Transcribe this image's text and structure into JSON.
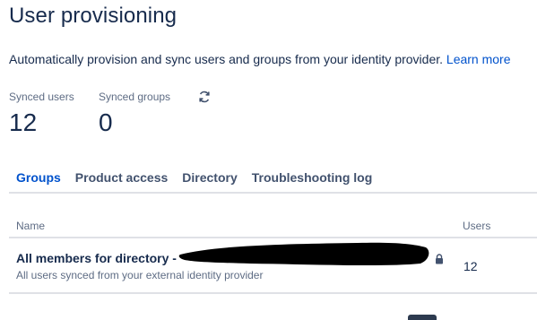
{
  "page": {
    "title": "User provisioning",
    "description": "Automatically provision and sync users and groups from your identity provider.",
    "learn_more_label": "Learn more"
  },
  "stats": {
    "synced_users_label": "Synced users",
    "synced_users_value": "12",
    "synced_groups_label": "Synced groups",
    "synced_groups_value": "0",
    "refresh_icon": "sync-icon"
  },
  "tabs": [
    {
      "label": "Groups",
      "active": true
    },
    {
      "label": "Product access",
      "active": false
    },
    {
      "label": "Directory",
      "active": false
    },
    {
      "label": "Troubleshooting log",
      "active": false
    }
  ],
  "table": {
    "columns": {
      "name": "Name",
      "users": "Users"
    },
    "rows": [
      {
        "title": "All members for directory -",
        "subtitle": "All users synced from your external identity provider",
        "users": "12",
        "locked_icon": "lock-icon"
      }
    ]
  },
  "colors": {
    "accent": "#0052cc",
    "text": "#172b4d",
    "muted": "#5e6c84",
    "divider": "#dfe1e6",
    "redaction": "#000000"
  }
}
